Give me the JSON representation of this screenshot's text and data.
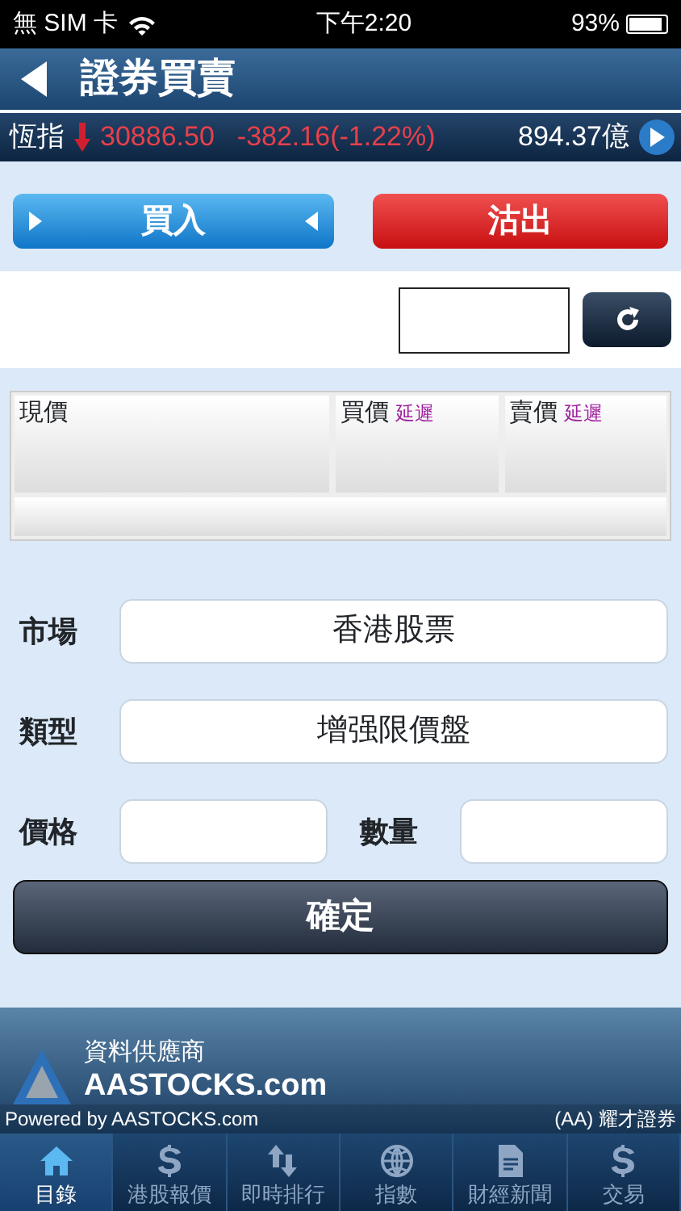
{
  "status_bar": {
    "carrier": "無 SIM 卡",
    "time": "下午2:20",
    "battery": "93%"
  },
  "header": {
    "title": "證券買賣"
  },
  "ticker": {
    "name": "恆指",
    "falling": true,
    "value": "30886.50",
    "change": "-382.16(-1.22%)",
    "turnover": "894.37億"
  },
  "trade_buttons": [
    {
      "label": "買入",
      "kind": "buy"
    },
    {
      "label": "沽出",
      "kind": "sell"
    }
  ],
  "quote": {
    "cells": [
      {
        "label": "現價"
      },
      {
        "label": "買價",
        "note": "延遲"
      },
      {
        "label": "賣價",
        "note": "延遲"
      }
    ]
  },
  "form": {
    "market": {
      "label": "市場",
      "value": "香港股票"
    },
    "type": {
      "label": "類型",
      "value": "增强限價盤"
    },
    "price": {
      "label": "價格"
    },
    "quantity": {
      "label": "數量"
    },
    "confirm": "確定"
  },
  "provider": {
    "title": "資料供應商",
    "name": "AASTOCKS.com",
    "powered": "Powered by AASTOCKS.com",
    "broker": "(AA) 耀才證券"
  },
  "tabs": [
    {
      "label": "目錄",
      "kind": "home",
      "selected": true
    },
    {
      "label": "港股報價",
      "kind": "quotes",
      "selected": false
    },
    {
      "label": "即時排行",
      "kind": "ranking",
      "selected": false
    },
    {
      "label": "指數",
      "kind": "index",
      "selected": false
    },
    {
      "label": "財經新聞",
      "kind": "news",
      "selected": false
    },
    {
      "label": "交易",
      "kind": "trade",
      "selected": false
    }
  ]
}
